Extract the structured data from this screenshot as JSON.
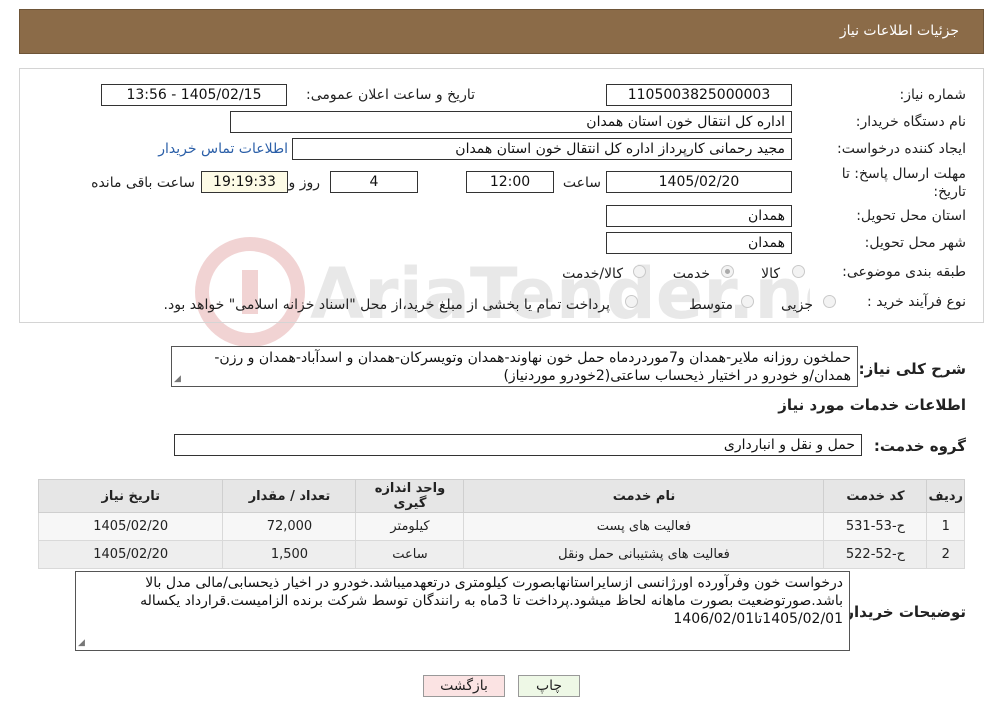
{
  "header": {
    "title": "جزئیات اطلاعات نیاز"
  },
  "form": {
    "need_number_label": "شماره نیاز:",
    "need_number": "1105003825000003",
    "announce_label": "تاریخ و ساعت اعلان عمومی:",
    "announce_value": "1405/02/15 - 13:56",
    "buyer_org_label": "نام دستگاه خریدار:",
    "buyer_org": "اداره کل انتقال خون استان همدان",
    "creator_label": "ایجاد کننده درخواست:",
    "creator": "مجید رحمانی کارپرداز اداره کل انتقال خون استان همدان",
    "contact_link": "اطلاعات تماس خریدار",
    "deadline_label_1": "مهلت ارسال پاسخ: تا",
    "deadline_label_2": "تاریخ:",
    "deadline_date": "1405/02/20",
    "time_label": "ساعت",
    "deadline_time": "12:00",
    "days_value": "4",
    "days_label": "روز و",
    "remaining_time": "19:19:33",
    "remaining_label": "ساعت باقی مانده",
    "province_label": "استان محل تحویل:",
    "province": "همدان",
    "city_label": "شهر محل تحویل:",
    "city": "همدان",
    "category_label": "طبقه بندی موضوعی:",
    "category_options": [
      "کالا",
      "خدمت",
      "کالا/خدمت"
    ],
    "category_selected": "خدمت",
    "purchase_type_label": "نوع فرآیند خرید :",
    "purchase_options": [
      "جزیی",
      "متوسط"
    ],
    "purchase_note": "پرداخت تمام یا بخشی از مبلغ خرید،از محل \"اسناد خزانه اسلامی\" خواهد بود."
  },
  "summary": {
    "label": "شرح کلی نیاز:",
    "text": "حملخون روزانه ملایر-همدان و7موردردماه حمل خون نهاوند-همدان وتویسرکان-همدان و اسدآباد-همدان و رزن-همدان/و خودرو در اختیار ذیحساب ساعتی(2خودرو موردنیاز)"
  },
  "services": {
    "section_title": "اطلاعات خدمات مورد نیاز",
    "group_label": "گروه خدمت:",
    "group_value": "حمل و نقل و انبارداری",
    "columns": [
      "ردیف",
      "کد خدمت",
      "نام خدمت",
      "واحد اندازه گیری",
      "تعداد / مقدار",
      "تاریخ نیاز"
    ],
    "rows": [
      [
        "1",
        "ح-53-531",
        "فعالیت های پست",
        "کیلومتر",
        "72,000",
        "1405/02/20"
      ],
      [
        "2",
        "ح-52-522",
        "فعالیت های پشتیبانی حمل ونقل",
        "ساعت",
        "1,500",
        "1405/02/20"
      ]
    ]
  },
  "buyer_notes": {
    "label": "توضیحات خریدار:",
    "text": "درخواست خون وفرآورده اورژانسی ازسایراستانهابصورت کیلومتری درتعهدمیباشد.خودرو در اخیار ذیحسابی/مالی مدل بالا باشد.صورتوضعیت بصورت ماهانه لحاظ میشود.پرداخت تا 3ماه به رانندگان توسط شرکت برنده الزامیست.قرارداد یکساله 1405/02/01تا1406/02/01"
  },
  "buttons": {
    "print": "چاپ",
    "back": "بازگشت"
  },
  "colors": {
    "header_bg": "#8b6b48",
    "back_button_bg": "#fbe3e3",
    "print_button_bg": "#eef8e6",
    "link": "#2b5fa8"
  }
}
